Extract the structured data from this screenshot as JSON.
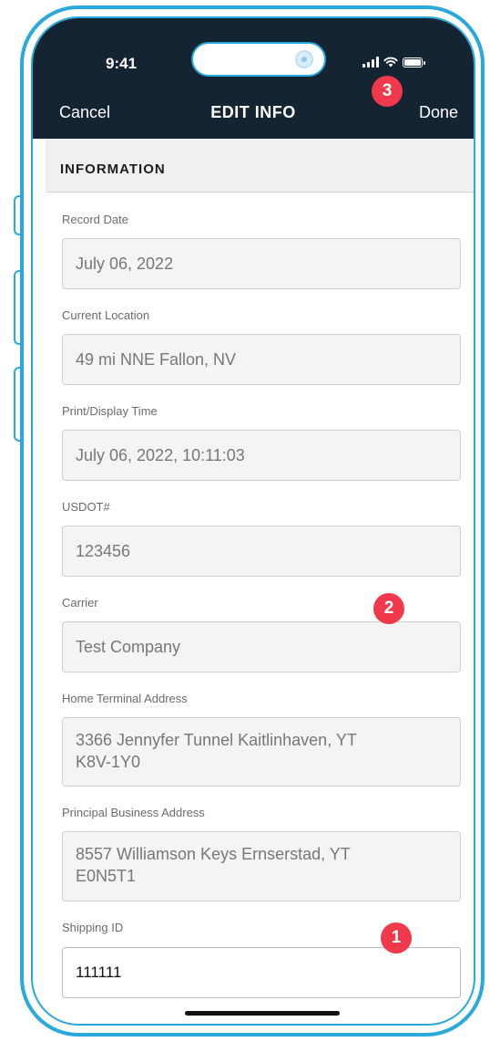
{
  "status_bar": {
    "time": "9:41"
  },
  "nav": {
    "cancel": "Cancel",
    "title": "EDIT INFO",
    "done": "Done"
  },
  "section": {
    "title": "INFORMATION"
  },
  "fields": {
    "record_date": {
      "label": "Record Date",
      "value": "July 06, 2022"
    },
    "current_location": {
      "label": "Current Location",
      "value": "49 mi NNE Fallon, NV"
    },
    "print_display_time": {
      "label": "Print/Display Time",
      "value": "July 06, 2022, 10:11:03"
    },
    "usdot": {
      "label": "USDOT#",
      "value": "123456"
    },
    "carrier": {
      "label": "Carrier",
      "value": "Test Company"
    },
    "home_terminal": {
      "label": "Home Terminal Address",
      "line1": "3366 Jennyfer Tunnel Kaitlinhaven, YT",
      "line2": "K8V-1Y0"
    },
    "principal_business": {
      "label": "Principal Business Address",
      "line1": "8557 Williamson Keys Ernserstad, YT",
      "line2": "E0N5T1"
    },
    "shipping_id": {
      "label": "Shipping ID",
      "value": "111111"
    }
  },
  "badges": {
    "one": "1",
    "two": "2",
    "three": "3"
  },
  "colors": {
    "header_bg": "#152433",
    "frame": "#29a8dc",
    "badge": "#f0394a"
  }
}
